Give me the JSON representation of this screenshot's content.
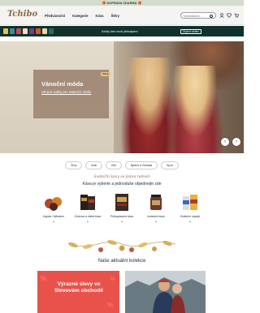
{
  "top_bar": {
    "text": "🎁 DOPRAVA ZDARMA 🎁"
  },
  "header": {
    "logo": "Tchibo",
    "nav": [
      "Předvánoční",
      "Kategorie",
      "Káva",
      "Štěry"
    ],
    "search_placeholder": "Vyhledávání..."
  },
  "promo_bar": {
    "text": "Každý den nová překvapení",
    "button": "Objevit vědění"
  },
  "hero": {
    "badge": "Nové",
    "title": "Vánoční móda",
    "link": "Hřejivé outfity pro sváteční chvíle"
  },
  "chips": [
    "Ženy",
    "Muži",
    "Děti",
    "Bydlení & Zahrada",
    "Sport"
  ],
  "tagline": "Sváteční kávy se jistou radostí",
  "subtitle": "Káva je vyberte a jednoduše objednejte zde",
  "categories": [
    {
      "label": "Kapsle Cafissimo"
    },
    {
      "label": "Zrnková a mletá káva"
    },
    {
      "label": "Překapávaná káva"
    },
    {
      "label": "Instantní káva"
    },
    {
      "label": "Sváteční nápoje"
    }
  ],
  "section_title": "Naše aktuální kolekce",
  "promo_tile": {
    "text": "Výrazné slevy ve Slevovém obchodě"
  },
  "colors": {
    "promo_bg": "#10312c",
    "hero_card": "#a08a76",
    "sale_red": "#e9524b",
    "brand_brown": "#8a6a4a"
  }
}
